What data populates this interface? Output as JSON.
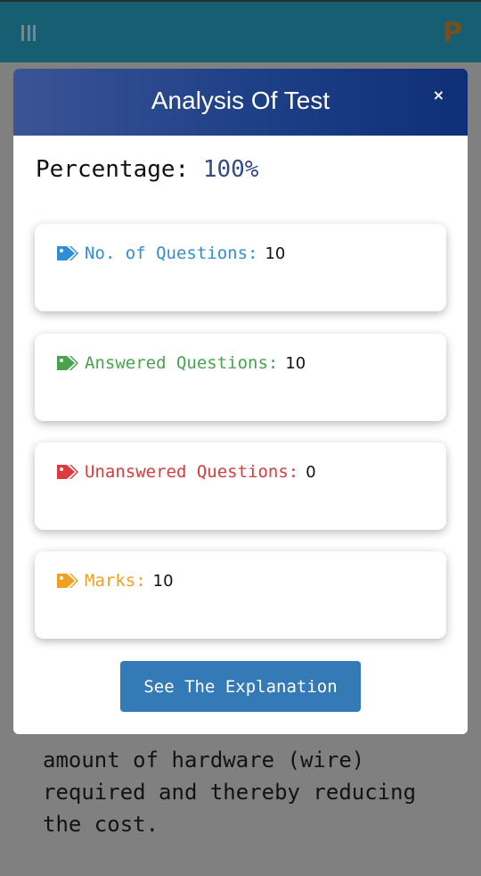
{
  "appbar": {
    "menu_icon": "hamburger-menu-icon",
    "logo_icon": "p-logo-icon",
    "logo_letter": "P",
    "color": "#27a4c4"
  },
  "background_text": "amount of hardware (wire) required and thereby reducing the cost.",
  "modal": {
    "title": "Analysis Of Test",
    "close_label": "×",
    "percentage_label": "Percentage:",
    "percentage_value": "100%",
    "stats": [
      {
        "label": "No. of Questions:",
        "value": "10",
        "color": "#2f8fd4",
        "icon": "tag-icon"
      },
      {
        "label": "Answered Questions:",
        "value": "10",
        "color": "#48a44c",
        "icon": "tag-icon"
      },
      {
        "label": "Unanswered Questions:",
        "value": "0",
        "color": "#dc3b3b",
        "icon": "tag-icon"
      },
      {
        "label": "Marks:",
        "value": "10",
        "color": "#f0a020",
        "icon": "tag-icon"
      }
    ],
    "explain_button": "See The Explanation",
    "header_color": "#1d3f86",
    "button_color": "#337ab7"
  }
}
